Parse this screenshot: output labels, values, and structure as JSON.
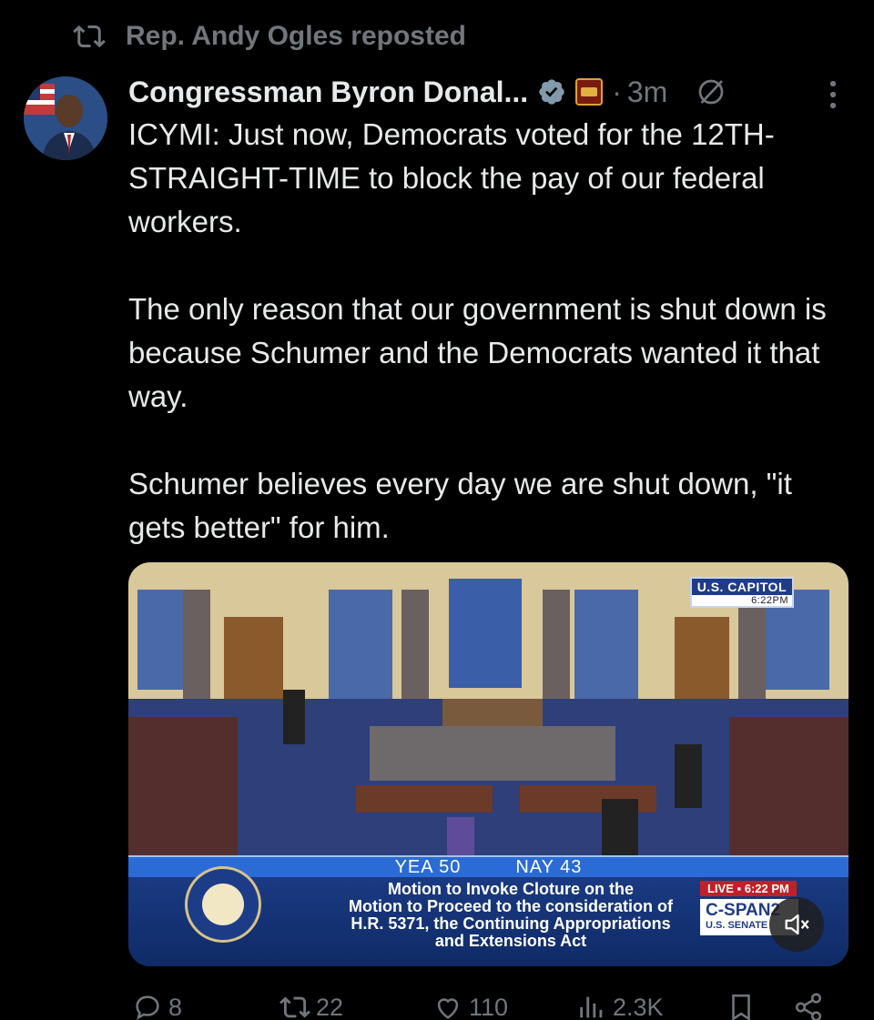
{
  "repost": {
    "text": "Rep. Andy Ogles reposted",
    "icon": "repost-icon"
  },
  "author": {
    "name": "Congressman Byron Donal...",
    "time": "3m",
    "separator": "·",
    "verified_color": "#829aab",
    "avatar": "avatar"
  },
  "tweet": {
    "paragraphs": [
      "ICYMI: Just now, Democrats voted for the 12TH-STRAIGHT-TIME to block the pay of our federal workers.",
      "The only reason that our government is shut down is because Schumer and the Democrats wanted it that way.",
      "Schumer believes every day we are shut down, \"it gets better\" for him."
    ]
  },
  "media": {
    "capitol_tag": "U.S. CAPITOL",
    "capitol_time": "6:22PM",
    "vote_yea": "YEA  50",
    "vote_nay": "NAY  43",
    "motion_lines": [
      "Motion to Invoke Cloture on the",
      "Motion to Proceed to the consideration of",
      "H.R. 5371, the Continuing Appropriations",
      "and Extensions Act"
    ],
    "live_label": "LIVE ▪ 6:22 PM",
    "network_name": "C-SPAN2",
    "network_sub": "U.S. SENATE"
  },
  "actions": {
    "replies": "8",
    "reposts": "22",
    "likes": "110",
    "views": "2.3K"
  },
  "colors": {
    "background": "#000000",
    "text": "#e7e9ea",
    "muted": "#71767b",
    "vote_bar": "#2a6bd6"
  }
}
